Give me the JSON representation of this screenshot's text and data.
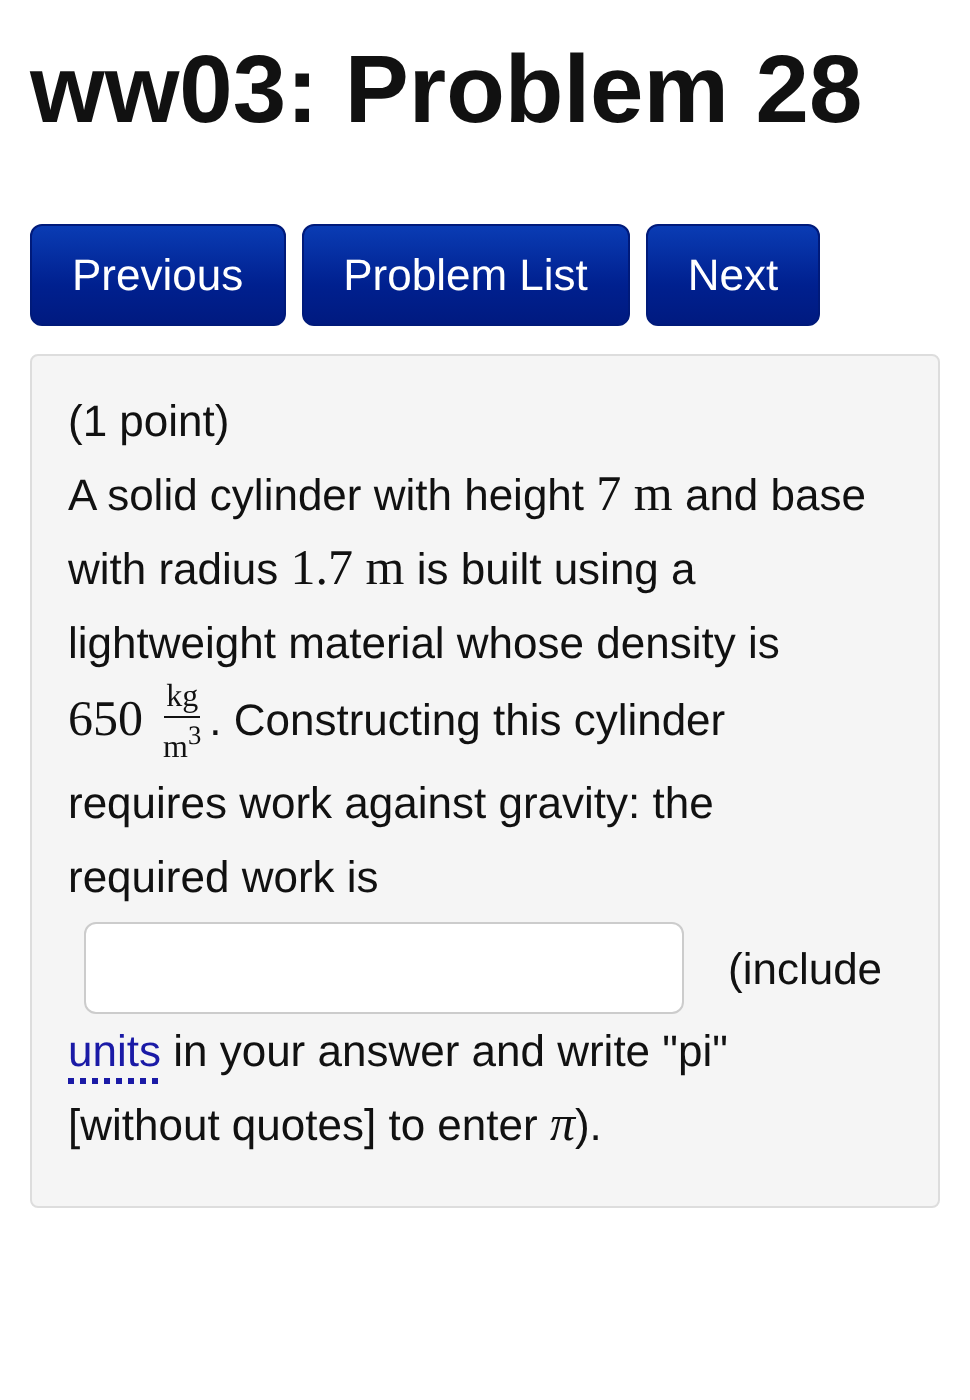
{
  "title": "ww03: Problem 28",
  "nav_buttons": [
    "Previous",
    "Problem List",
    "Next"
  ],
  "problem": {
    "points": "(1 point)",
    "statement": [
      {
        "kind": "text",
        "text": "A solid cylinder with height "
      },
      {
        "kind": "math",
        "text": "7 m"
      },
      {
        "kind": "text",
        "text": " and base with radius "
      },
      {
        "kind": "math",
        "text": "1.7 m"
      },
      {
        "kind": "text",
        "text": " is built using a lightweight material whose density is "
      },
      {
        "kind": "math",
        "text": "650"
      },
      {
        "kind": "fraction",
        "numerator": "kg",
        "denominator": "m$^{3}$"
      },
      {
        "kind": "text",
        "text": ". Constructing this cylinder requires work against gravity: the required work is"
      }
    ],
    "answer_note": "(include",
    "hint": [
      {
        "kind": "link",
        "text": "units"
      },
      {
        "kind": "text",
        "text": " in your answer and write \"pi\" [without quotes] to enter "
      },
      {
        "kind": "var",
        "text": "π"
      },
      {
        "kind": "text",
        "text": ")."
      }
    ]
  }
}
